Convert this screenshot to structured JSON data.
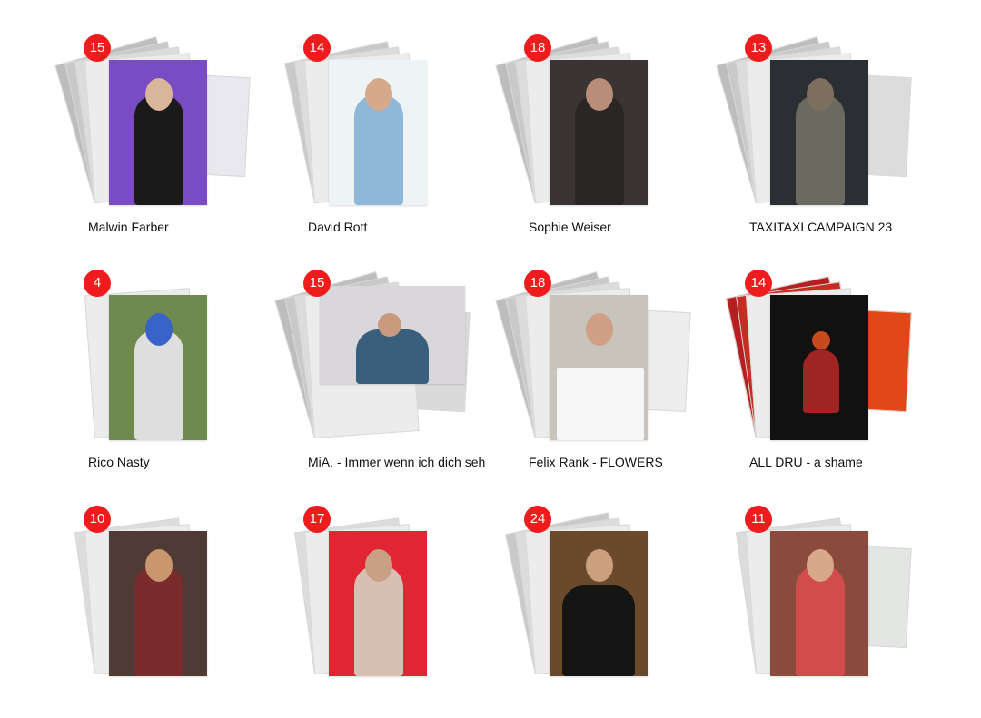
{
  "gallery": {
    "items": [
      {
        "count": "15",
        "title": "Malwin Farber",
        "colors": {
          "bg": "#7a4cc4",
          "figure": "#1a1a1a",
          "head": "#d9b59a",
          "side": "#e8e8ee"
        }
      },
      {
        "count": "14",
        "title": "David Rott",
        "colors": {
          "bg": "#eef3f6",
          "figure": "#8fb8d8",
          "head": "#d6a98a",
          "side": "#efefef"
        }
      },
      {
        "count": "18",
        "title": "Sophie Weiser",
        "colors": {
          "bg": "#3a3434",
          "figure": "#2b2626",
          "head": "#b88e78",
          "side": "#e5e5e5"
        }
      },
      {
        "count": "13",
        "title": "TAXITAXI CAMPAIGN 23",
        "colors": {
          "bg": "#2b2f33",
          "figure": "#6b6a60",
          "head": "#7e6e5d",
          "side": "#dcdcdc"
        }
      },
      {
        "count": "4",
        "title": "Rico Nasty",
        "colors": {
          "bg": "#6f8a4f",
          "figure": "#dedede",
          "head": "#3a63c9",
          "side": "#f0f0f0"
        }
      },
      {
        "count": "15",
        "title": "MiA. - Immer wenn ich dich seh",
        "colors": {
          "bg": "#d9d6dc",
          "figure": "#395f7c",
          "head": "#c99a7d",
          "side": "#dadada"
        }
      },
      {
        "count": "18",
        "title": "Felix Rank - FLOWERS",
        "colors": {
          "bg": "#c9c4bb",
          "figure": "#f6f6f6",
          "head": "#cf9f86",
          "side": "#ededed"
        }
      },
      {
        "count": "14",
        "title": "ALL DRU - a shame",
        "colors": {
          "bg": "#111111",
          "figure": "#a12424",
          "head": "#c64a1e",
          "side": "#e0481a"
        }
      },
      {
        "count": "10",
        "title": "",
        "colors": {
          "bg": "#4e3b36",
          "figure": "#7a2c2c",
          "head": "#c9966e",
          "side": "#e9e9e9"
        }
      },
      {
        "count": "17",
        "title": "",
        "colors": {
          "bg": "#e02632",
          "figure": "#d8bfb3",
          "head": "#caa084",
          "side": "#ececec"
        }
      },
      {
        "count": "24",
        "title": "",
        "colors": {
          "bg": "#6a4a2a",
          "figure": "#151515",
          "head": "#caa07e",
          "side": "#e6e6e6"
        }
      },
      {
        "count": "11",
        "title": "",
        "colors": {
          "bg": "#8a4a3c",
          "figure": "#d24c4c",
          "head": "#d8a88a",
          "side": "#e3e6e2"
        }
      }
    ]
  }
}
